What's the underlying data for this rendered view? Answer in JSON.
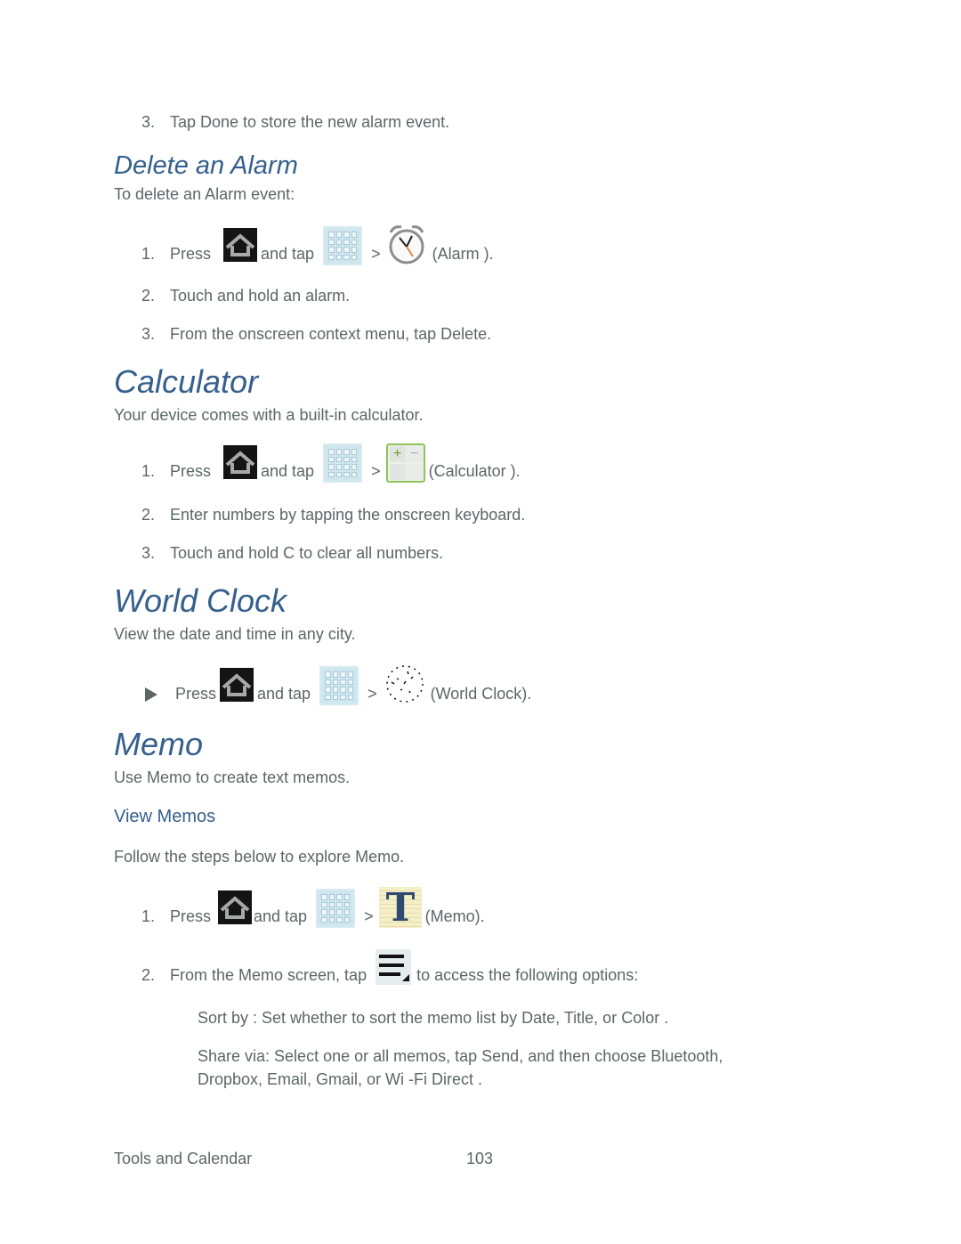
{
  "page": {
    "prev_step": {
      "num": "3.",
      "text": "Tap Done to store the new alarm event."
    },
    "delete_alarm": {
      "heading": "Delete an Alarm",
      "intro": "To delete an Alarm event:",
      "steps": [
        {
          "num": "1.",
          "press": "Press",
          "and_tap": "and tap",
          "gt": ">",
          "target": "(Alarm )."
        },
        {
          "num": "2.",
          "text": "Touch and hold an alarm."
        },
        {
          "num": "3.",
          "text": "From the onscreen context menu, tap Delete."
        }
      ]
    },
    "calculator": {
      "heading": "Calculator",
      "intro": "Your device comes with a built-in calculator.",
      "steps": [
        {
          "num": "1.",
          "press": "Press",
          "and_tap": "and tap",
          "gt": ">",
          "target": "(Calculator )."
        },
        {
          "num": "2.",
          "text": "Enter numbers by tapping the onscreen keyboard."
        },
        {
          "num": "3.",
          "text": "Touch and hold C to clear all numbers."
        }
      ]
    },
    "world_clock": {
      "heading": "World Clock",
      "intro": "View the date and time in any city.",
      "step": {
        "press": "Press",
        "and_tap": "and tap",
        "gt": ">",
        "target": "(World Clock)."
      }
    },
    "memo": {
      "heading": "Memo",
      "intro": "Use Memo to create text memos.",
      "subheading": "View Memos",
      "sub_intro": "Follow the steps below to explore Memo.",
      "steps": [
        {
          "num": "1.",
          "press": "Press",
          "and_tap": "and tap",
          "gt": ">",
          "target": "(Memo)."
        },
        {
          "num": "2.",
          "before": "From the Memo screen, tap",
          "after": "to access the following options:"
        }
      ],
      "options": [
        {
          "text": "Sort by : Set whether to sort the memo list by Date, Title, or Color ."
        },
        {
          "line1": "Share via:  Select one or all memos, tap Send, and then choose Bluetooth,",
          "line2": "Dropbox,  Email,  Gmail, or Wi -Fi Direct ."
        }
      ]
    },
    "footer": {
      "section": "Tools and Calendar",
      "page_number": "103"
    }
  },
  "icons": {
    "home": "home-icon",
    "apps": "apps-grid-icon",
    "alarm": "alarm-clock-icon",
    "calculator": "calculator-icon",
    "world_clock": "world-clock-icon",
    "memo": "memo-icon",
    "menu": "menu-icon",
    "bullet": "triangle-bullet-icon"
  },
  "colors": {
    "heading": "#355f8c",
    "body": "#5b6766"
  }
}
